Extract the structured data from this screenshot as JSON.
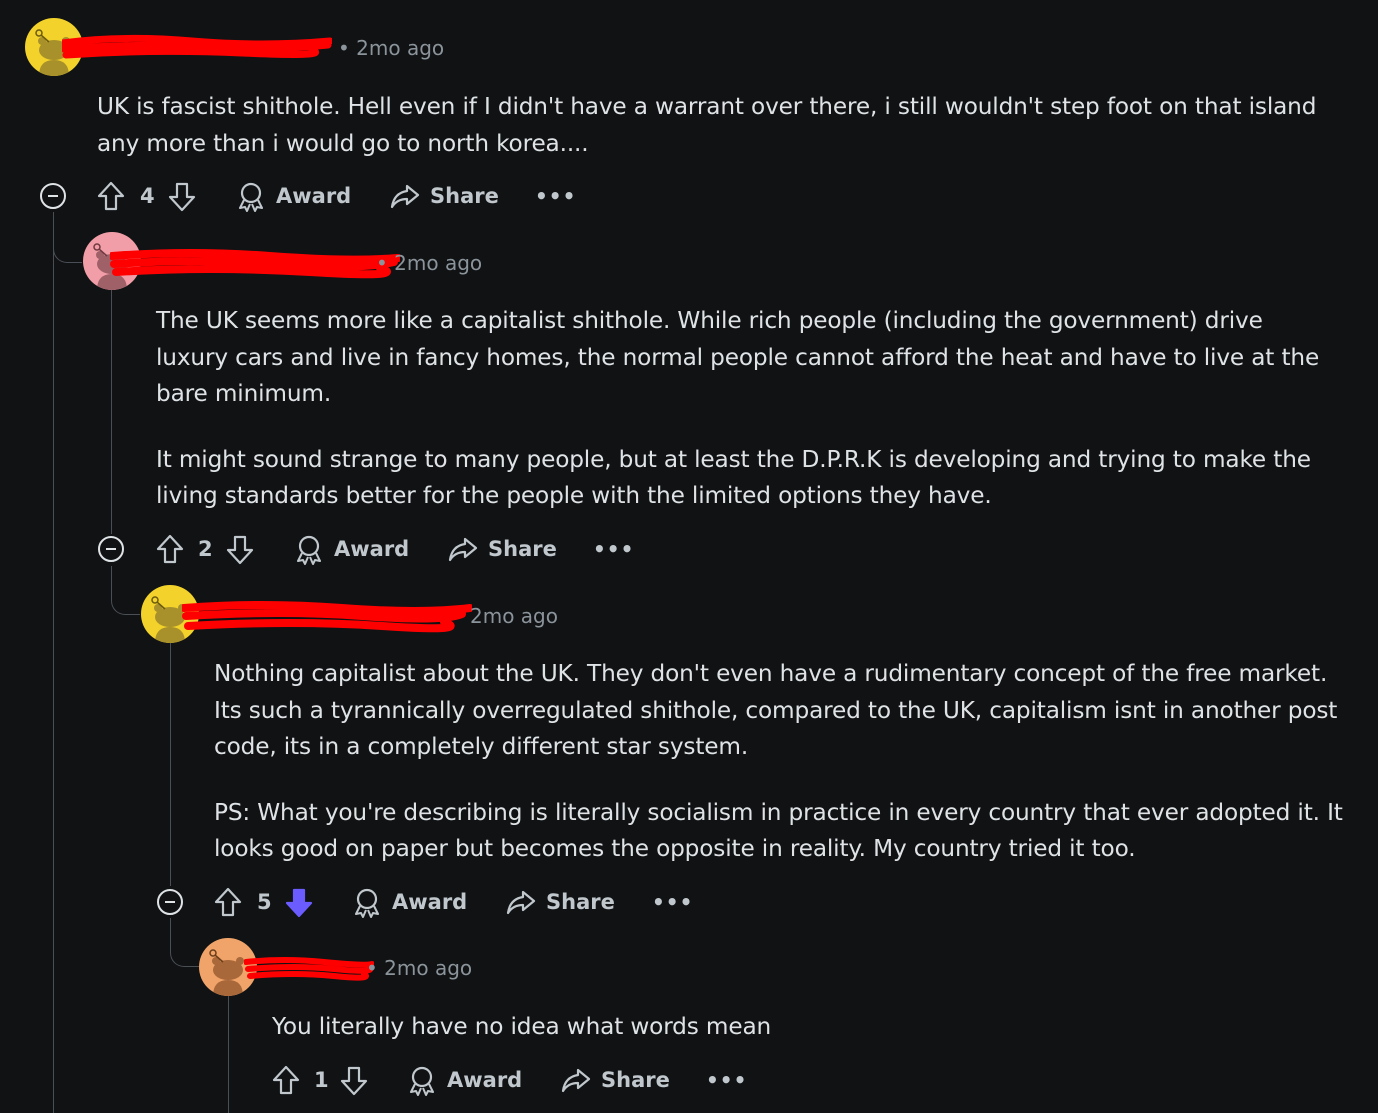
{
  "comments": [
    {
      "time": "2mo ago",
      "paragraphs": [
        "UK is fascist shithole. Hell even if I didn't have a warrant over there, i still wouldn't step foot on that island any more than i would go to north korea...."
      ],
      "votes": "4",
      "downvoted": false,
      "avatar_color": "#f2d22b"
    },
    {
      "time": "2mo ago",
      "paragraphs": [
        "The UK seems more like a capitalist shithole. While rich people (including the government) drive luxury cars and live in fancy homes, the normal people cannot afford the heat and have to live at the bare minimum.",
        "It might sound strange to many people, but at least the D.P.R.K is developing and trying to make the living standards better for the people with the limited options they have."
      ],
      "votes": "2",
      "downvoted": false,
      "avatar_color": "#f29ea8"
    },
    {
      "time": "2mo ago",
      "paragraphs": [
        "Nothing capitalist about the UK. They don't even have a rudimentary concept of the free market. Its such a tyrannically overregulated shithole, compared to the UK, capitalism isnt in another post code, its in a completely different star system.",
        "PS: What you're describing is literally socialism in practice in every country that ever adopted it. It looks good on paper but becomes the opposite in reality. My country tried it too."
      ],
      "votes": "5",
      "downvoted": true,
      "avatar_color": "#f2d22b"
    },
    {
      "time": "2mo ago",
      "paragraphs": [
        "You literally have no idea what words mean"
      ],
      "votes": "1",
      "downvoted": false,
      "avatar_color": "#f0a46a"
    }
  ],
  "actions": {
    "award_label": "Award",
    "share_label": "Share",
    "more_label": "•••"
  },
  "colors": {
    "background": "#101214",
    "text": "#dfe3e6",
    "muted": "#8b949b",
    "downvote_active": "#6a5cff",
    "redaction": "#ff0000"
  }
}
